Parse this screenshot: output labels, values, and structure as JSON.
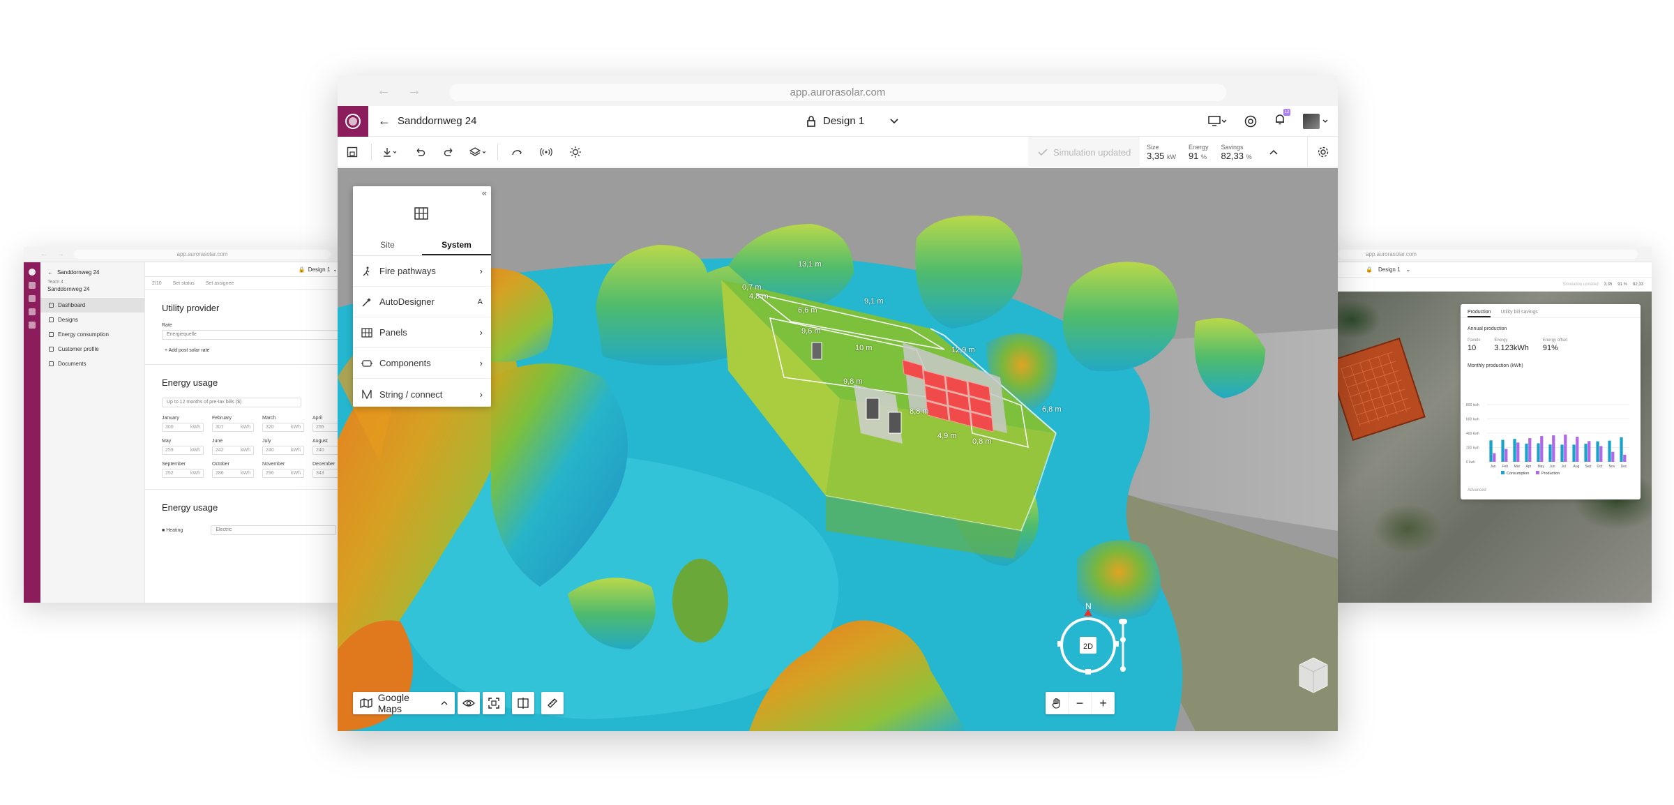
{
  "left_window": {
    "url": "app.aurorasolar.com",
    "project": "Sanddornweg 24",
    "team": "Team 4",
    "project_sub": "Sanddornweg 24",
    "design": "Design 1",
    "sidebar": [
      {
        "label": "Dashboard",
        "active": true
      },
      {
        "label": "Designs",
        "active": false
      },
      {
        "label": "Energy consumption",
        "active": false
      },
      {
        "label": "Customer profile",
        "active": false
      },
      {
        "label": "Documents",
        "active": false
      }
    ],
    "filters": {
      "progress": "2/10",
      "status": "Set status",
      "assignee": "Set assignee"
    },
    "utility": {
      "title": "Utility provider",
      "rate_label": "Rate",
      "rate_value": "Energiequelle",
      "add_rate": "Add post solar rate"
    },
    "usage": {
      "title": "Energy usage",
      "dropdown": "Up to 12 months of pre-tax bills ($)",
      "months": [
        {
          "name": "January",
          "value": "300",
          "unit": "kWh"
        },
        {
          "name": "February",
          "value": "307",
          "unit": "kWh"
        },
        {
          "name": "March",
          "value": "320",
          "unit": "kWh"
        },
        {
          "name": "April",
          "value": "255",
          "unit": "kWh"
        },
        {
          "name": "May",
          "value": "259",
          "unit": "kWh"
        },
        {
          "name": "June",
          "value": "242",
          "unit": "kWh"
        },
        {
          "name": "July",
          "value": "240",
          "unit": "kWh"
        },
        {
          "name": "August",
          "value": "240",
          "unit": "kWh"
        },
        {
          "name": "September",
          "value": "252",
          "unit": "kWh"
        },
        {
          "name": "October",
          "value": "286",
          "unit": "kWh"
        },
        {
          "name": "November",
          "value": "296",
          "unit": "kWh"
        },
        {
          "name": "December",
          "value": "343",
          "unit": "kWh"
        }
      ]
    },
    "usage2": {
      "title": "Energy usage",
      "heating_label": "Heating",
      "heating_value": "Electric"
    }
  },
  "right_window": {
    "url": "app.aurorasolar.com",
    "design": "Design 1",
    "sim": "Simulation updated",
    "mini_metrics": [
      {
        "label": "Size",
        "value": "3,35"
      },
      {
        "label": "Energy",
        "value": "91 %"
      },
      {
        "label": "Savings",
        "value": "82,33"
      }
    ],
    "card": {
      "tabs": [
        "Production",
        "Utility bill savings"
      ],
      "annual": "Annual production",
      "stats": [
        {
          "label": "Panels",
          "value": "10"
        },
        {
          "label": "Energy",
          "value": "3.123kWh"
        },
        {
          "label": "Energy offset",
          "value": "91%"
        }
      ],
      "monthly_title": "Monthly production (kWh)",
      "legend": [
        "Consumption",
        "Production"
      ],
      "advanced": "Advanced"
    }
  },
  "chart_data": {
    "type": "bar",
    "title": "Monthly production (kWh)",
    "categories": [
      "Jan",
      "Feb",
      "Mar",
      "Apr",
      "May",
      "Jun",
      "Jul",
      "Aug",
      "Sep",
      "Oct",
      "Nov",
      "Dec"
    ],
    "y_ticks": [
      "800 kwh",
      "600 kwh",
      "400 kwh",
      "200 kwh",
      "0 kwh"
    ],
    "ylim": [
      0,
      800
    ],
    "series": [
      {
        "name": "Consumption",
        "color": "#1aa3c8",
        "values": [
          300,
          307,
          320,
          255,
          259,
          242,
          240,
          240,
          252,
          286,
          296,
          343
        ]
      },
      {
        "name": "Production",
        "color": "#b168e8",
        "values": [
          120,
          180,
          270,
          330,
          360,
          370,
          380,
          350,
          290,
          220,
          140,
          100
        ]
      }
    ],
    "legend": "bottom"
  },
  "main": {
    "url": "app.aurorasolar.com",
    "project": "Sanddornweg 24",
    "design": "Design 1",
    "notifications": "12",
    "sim_status": "Simulation updated",
    "metrics": [
      {
        "label": "Size",
        "value": "3,35",
        "unit": "kW"
      },
      {
        "label": "Energy",
        "value": "91",
        "unit": "%"
      },
      {
        "label": "Savings",
        "value": "82,33",
        "unit": "%"
      }
    ],
    "panel": {
      "tabs": [
        "Site",
        "System"
      ],
      "active_tab": "System",
      "rows": [
        {
          "label": "Fire pathways",
          "right": ">"
        },
        {
          "label": "AutoDesigner",
          "right": "A"
        },
        {
          "label": "Panels",
          "right": ">"
        },
        {
          "label": "Components",
          "right": ">"
        },
        {
          "label": "String / connect",
          "right": ">"
        }
      ]
    },
    "map_source": "Google Maps",
    "compass": {
      "north": "N",
      "mode": "2D"
    },
    "dimensions": [
      "13,1 m",
      "4,8 m",
      "0,7 m",
      "6,6 m",
      "9,1 m",
      "9,6 m",
      "10 m",
      "9,8 m",
      "12,9 m",
      "6,8 m",
      "8,8 m",
      "4,9 m",
      "0,8 m"
    ],
    "colors": {
      "brand": "#8c1d5c",
      "accent": "#a97ff0"
    }
  }
}
